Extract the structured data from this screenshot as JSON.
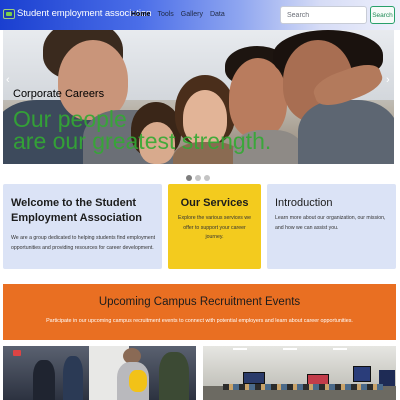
{
  "navbar": {
    "brand": "Student employment association",
    "links": [
      "Home",
      "Tools",
      "Gallery",
      "Data"
    ],
    "active_link": "Home",
    "search_placeholder": "Search",
    "search_button": "Search"
  },
  "carousel": {
    "subtitle": "Corporate Careers",
    "title_line1": "Our people",
    "title_line2": "are our greatest strength.",
    "prev_icon": "‹",
    "next_icon": "›",
    "slide_count": 3,
    "active_slide": 1
  },
  "cards": {
    "welcome": {
      "title": "Welcome to the Student Employment Association",
      "text": "We are a group dedicated to helping students find employment opportunities and providing resources for career development."
    },
    "services": {
      "title": "Our Services",
      "text": "Explore the various services we offer to support your career journey."
    },
    "intro": {
      "title": "Introduction",
      "text": "Learn more about our organization, our mission, and how we can assist you."
    }
  },
  "events": {
    "title": "Upcoming Campus Recruitment Events",
    "text": "Participate in our upcoming campus recruitment events to connect with potential employers and learn about career opportunities."
  },
  "colors": {
    "nav_start": "#1a3fd0",
    "card_blue": "#dbe3f6",
    "services_yellow": "#f3cb1e",
    "events_orange": "#e96f22",
    "caption_green": "#33aa33"
  }
}
